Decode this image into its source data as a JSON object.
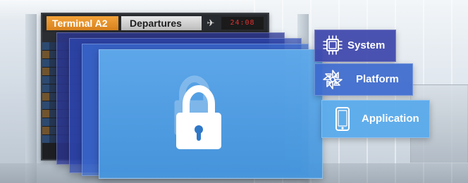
{
  "board": {
    "terminal_label": "Terminal A2",
    "departures_label": "Departures",
    "time_text": "24:08 18:08"
  },
  "stack": {
    "system_label": "System",
    "platform_label": "Platform",
    "application_label": "Application"
  },
  "icons": {
    "plane": "airplane-icon",
    "lock": "padlock-icon",
    "chip": "chip-icon",
    "platform": "platform-icon",
    "phone": "phone-icon"
  },
  "colors": {
    "system_bg": "#3c44aa",
    "platform_bg": "#3c69cd",
    "application_bg": "#5aaaeb",
    "front_panel": "#5fb0ea"
  }
}
